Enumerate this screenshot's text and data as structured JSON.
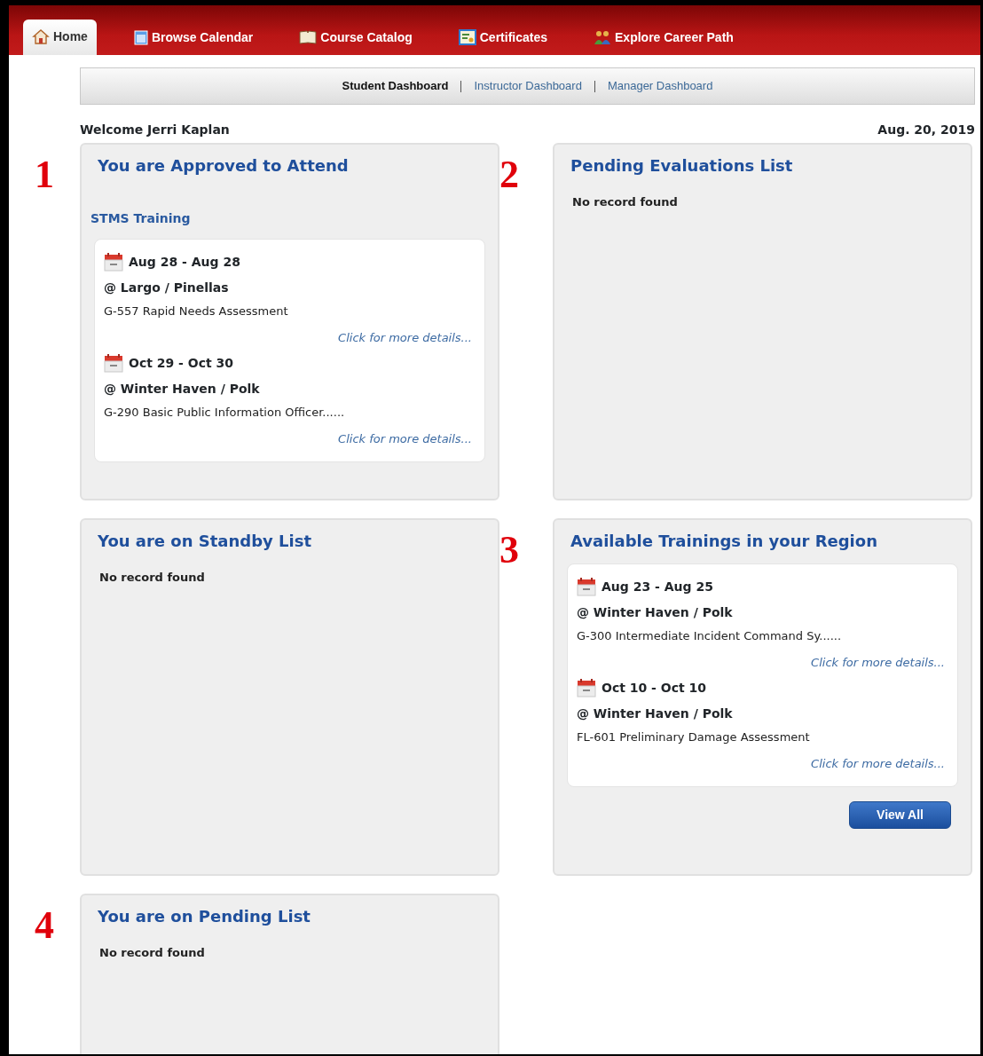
{
  "nav_tabs": [
    {
      "label": "Home",
      "selected": true
    },
    {
      "label": "Browse Calendar",
      "selected": false
    },
    {
      "label": "Course Catalog",
      "selected": false
    },
    {
      "label": "Certificates",
      "selected": false
    },
    {
      "label": "Explore Career Path",
      "selected": false
    }
  ],
  "sub_nav": [
    {
      "label": "Student Dashboard",
      "selected": true
    },
    {
      "label": "Instructor Dashboard",
      "selected": false
    },
    {
      "label": "Manager Dashboard",
      "selected": false
    }
  ],
  "welcome": "Welcome Jerri Kaplan",
  "date": "Aug. 20, 2019",
  "panels": [
    {
      "marker": "1",
      "title": "You are Approved to Attend",
      "subtitle": "STMS Training",
      "trainings": [
        {
          "dates": "Aug 28 - Aug 28",
          "location": "@ Largo / Pinellas",
          "course": "G-557 Rapid Needs Assessment",
          "link": "Click for more details..."
        },
        {
          "dates": "Oct 29 - Oct 30",
          "location": "@ Winter Haven / Polk",
          "course": "G-290 Basic Public Information Officer......",
          "link": "Click for more details..."
        }
      ]
    },
    {
      "marker": "2",
      "title": "Pending Evaluations List",
      "message": "No record found"
    },
    {
      "title": "You are on Standby List",
      "message": "No record found"
    },
    {
      "marker": "3",
      "title": "Available Trainings in your Region",
      "trainings": [
        {
          "dates": "Aug 23 - Aug 25",
          "location": "@ Winter Haven / Polk",
          "course": "G-300 Intermediate Incident Command Sy......",
          "link": "Click for more details..."
        },
        {
          "dates": "Oct 10 - Oct 10",
          "location": "@ Winter Haven / Polk",
          "course": "FL-601 Preliminary Damage Assessment",
          "link": "Click for more details..."
        }
      ],
      "button": "View All"
    },
    {
      "marker": "4",
      "title": "You are on Pending List",
      "message": "No record found"
    }
  ]
}
